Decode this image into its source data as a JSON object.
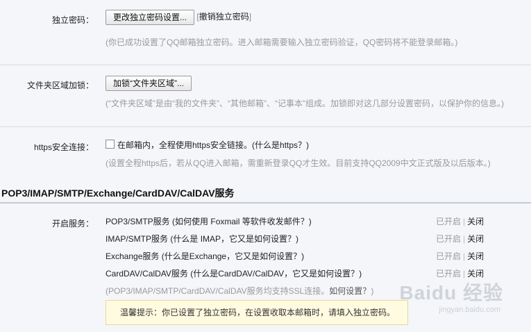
{
  "password": {
    "label": "独立密码：",
    "change_button": "更改独立密码设置...",
    "bracket_open": "[",
    "cancel_link": "撤销独立密码",
    "bracket_close": "]",
    "hint": "(你已成功设置了QQ邮箱独立密码。进入邮箱需要输入独立密码验证，QQ密码将不能登录邮箱。)"
  },
  "folder_lock": {
    "label": "文件夹区域加锁：",
    "lock_button": "加锁“文件夹区域”...",
    "hint": "(“文件夹区域”是由“我的文件夹”、“其他邮箱”、“记事本”组成。加锁即对这几部分设置密码，以保护你的信息。)"
  },
  "https": {
    "label": "https安全连接：",
    "checkbox_label": "在邮箱内，全程使用https安全链接。",
    "what_link": "(什么是https？)",
    "hint": "(设置全程https后，若从QQ进入邮箱，需重新登录QQ才生效。目前支持QQ2009中文正式版及以后版本。)"
  },
  "services": {
    "section_title": "POP3/IMAP/SMTP/Exchange/CardDAV/CalDAV服务",
    "label": "开启服务：",
    "items": [
      {
        "name": "POP3/SMTP服务",
        "question": "(如何使用 Foxmail 等软件收发邮件？)",
        "status_on": "已开启",
        "pipe": "|",
        "action_off": "关闭"
      },
      {
        "name": "IMAP/SMTP服务",
        "question": "(什么是 IMAP，它又是如何设置？)",
        "status_on": "已开启",
        "pipe": "|",
        "action_off": "关闭"
      },
      {
        "name": "Exchange服务",
        "question": "(什么是Exchange，它又是如何设置？)",
        "status_on": "已开启",
        "pipe": "|",
        "action_off": "关闭"
      },
      {
        "name": "CardDAV/CalDAV服务",
        "question": "(什么是CardDAV/CalDAV，它又是如何设置？)",
        "status_on": "已开启",
        "pipe": "|",
        "action_off": "关闭"
      }
    ],
    "ssl_note": "(POP3/IMAP/SMTP/CardDAV/CalDAV服务均支持SSL连接。",
    "ssl_link": "如何设置？",
    "ssl_close": ")",
    "tip": "温馨提示：你已设置了独立密码，在设置收取本邮箱时，请填入独立密码。"
  },
  "watermark": {
    "text": "Baidu 经验",
    "sub": "jingyan.baidu.com"
  }
}
